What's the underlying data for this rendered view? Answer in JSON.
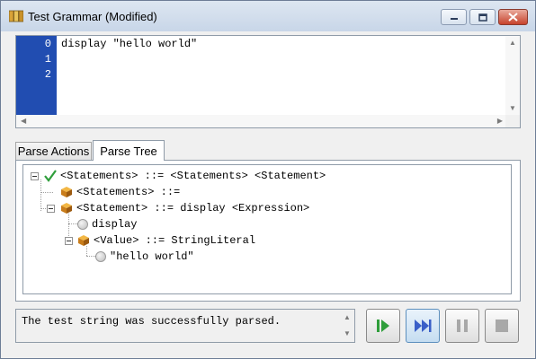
{
  "window": {
    "title": "Test Grammar (Modified)",
    "icons": {
      "app": "grammar-book-icon",
      "minimize": "minimize-icon",
      "maximize": "maximize-icon",
      "close": "close-icon"
    }
  },
  "editor": {
    "line_numbers": [
      "0",
      "1",
      "2"
    ],
    "code_lines": [
      "display \"hello world\"",
      "",
      ""
    ],
    "gutter_color": "#214db1"
  },
  "tabs": [
    {
      "label": "Parse Actions",
      "active": false
    },
    {
      "label": "Parse Tree",
      "active": true
    }
  ],
  "parse_tree": {
    "nodes": [
      {
        "label": "<Statements> ::= <Statements> <Statement>",
        "icon": "check-icon",
        "expanded": true
      },
      {
        "label": "<Statements> ::=",
        "icon": "cube-icon"
      },
      {
        "label": "<Statement> ::= display <Expression>",
        "icon": "cube-icon",
        "expanded": true
      },
      {
        "label": "display",
        "icon": "circle-icon"
      },
      {
        "label": "<Value> ::= StringLiteral",
        "icon": "cube-icon",
        "expanded": true
      },
      {
        "label": "\"hello world\"",
        "icon": "circle-icon"
      }
    ]
  },
  "status": {
    "message": "The test string was successfully parsed."
  },
  "controls": [
    {
      "name": "parse-step-button",
      "icon": "play-step-icon",
      "enabled": true
    },
    {
      "name": "parse-run-button",
      "icon": "fast-forward-icon",
      "enabled": true
    },
    {
      "name": "pause-button",
      "icon": "pause-icon",
      "enabled": false
    },
    {
      "name": "stop-button",
      "icon": "stop-icon",
      "enabled": false
    }
  ],
  "colors": {
    "play_green": "#2f9e3b",
    "ff_blue": "#3a5fc8",
    "disabled": "#a8a8a8"
  }
}
